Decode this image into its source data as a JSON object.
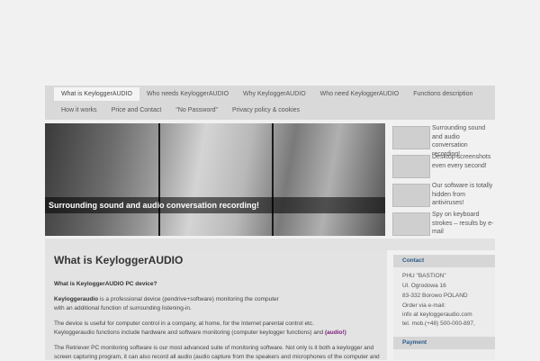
{
  "nav": {
    "row1": [
      {
        "label": "What is KeyloggerAUDIO",
        "active": true
      },
      {
        "label": "Who needs KeyloggerAUDIO",
        "active": false
      },
      {
        "label": "Why KeyloggerAUDIO",
        "active": false
      },
      {
        "label": "Who need KeyloggerAUDIO",
        "active": false
      },
      {
        "label": "Functions description",
        "active": false
      }
    ],
    "row2": [
      {
        "label": "How it works"
      },
      {
        "label": "Price and Contact"
      },
      {
        "label": "\"No Password\""
      },
      {
        "label": "Privacy policy & cookies"
      }
    ]
  },
  "slider": {
    "caption": "Surrounding sound and audio conversation recording!"
  },
  "thumbs": [
    {
      "text": "Surrounding sound and audio conversation recording!"
    },
    {
      "text": "Desktop screenshots even every second!"
    },
    {
      "text": "Our software is totally hidden from antiviruses!"
    },
    {
      "text": "Spy on keyboard strokes – results by e-mail"
    }
  ],
  "main": {
    "title": "What is KeyloggerAUDIO",
    "subtitle": "What is KeyloggerAUDIO PC device?",
    "p1_brand": "Keyloggeraudio",
    "p1_rest": " is a professional device (pendrive+software) monitoring the computer",
    "p1_line2": "with an additional function of surrounding listening-in.",
    "p2_line1": "The device is useful for computer control in a company, at home, for the Internet parental control etc.",
    "p2_line2": "Keyloggeraudio functions include hardware and software monitoring (computer keylogger functions) and ",
    "p2_link": "(audio!)",
    "p3_line1": "The Retriever PC monitoring software is our most advanced suite of monitoring software. Not only is it both a keylogger and",
    "p3_line2": "screen capturing program, it can also record all audio (audio capture from the speakers and microphones of the computer and"
  },
  "sidebar": {
    "contact_title": "Contact",
    "contact_lines": [
      "PHU \"BASTION\"",
      "Ul. Ogrodowa 16",
      "83-332 Borowo POLAND",
      "Order via e-mail:",
      "info at keyloggeraudio.com",
      "tel. mob.(+48) 500-000-897,"
    ],
    "payment_title": "Payment"
  }
}
